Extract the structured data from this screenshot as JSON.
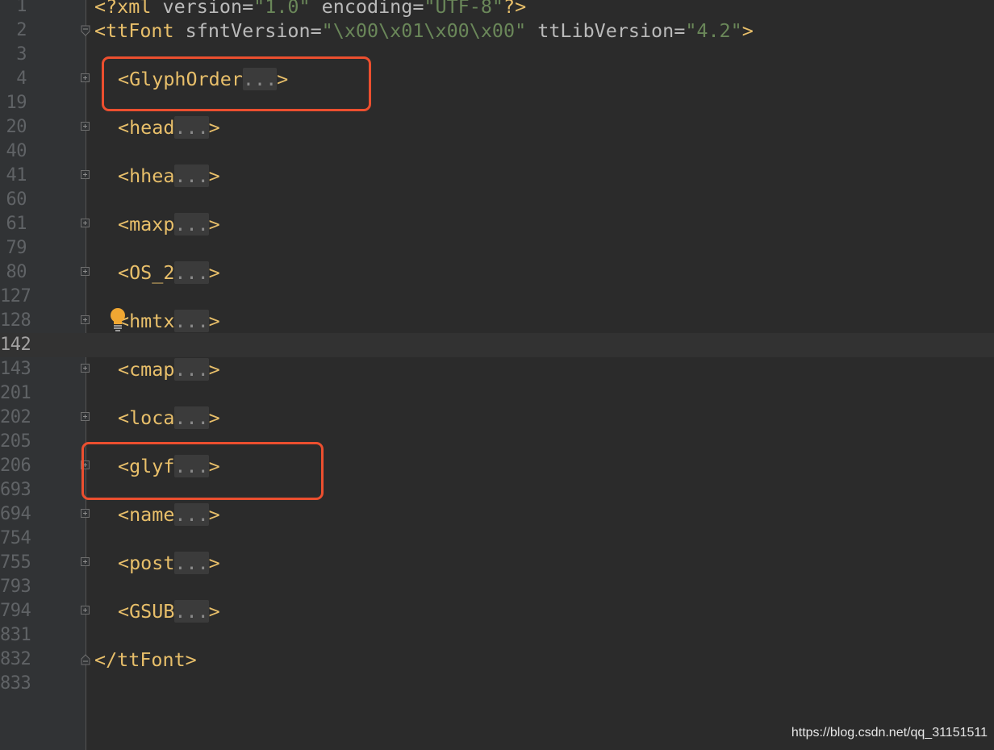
{
  "editor": {
    "lines": [
      {
        "no": "1",
        "indent": 0,
        "kind": "decl"
      },
      {
        "no": "2",
        "indent": 0,
        "kind": "root-open"
      },
      {
        "no": "3",
        "indent": 0,
        "kind": "blank"
      },
      {
        "no": "4",
        "indent": 1,
        "kind": "fold",
        "tag": "<GlyphOrder"
      },
      {
        "no": "19",
        "indent": 0,
        "kind": "blank"
      },
      {
        "no": "20",
        "indent": 1,
        "kind": "fold",
        "tag": "<head"
      },
      {
        "no": "40",
        "indent": 0,
        "kind": "blank"
      },
      {
        "no": "41",
        "indent": 1,
        "kind": "fold",
        "tag": "<hhea"
      },
      {
        "no": "60",
        "indent": 0,
        "kind": "blank"
      },
      {
        "no": "61",
        "indent": 1,
        "kind": "fold",
        "tag": "<maxp"
      },
      {
        "no": "79",
        "indent": 0,
        "kind": "blank"
      },
      {
        "no": "80",
        "indent": 1,
        "kind": "fold",
        "tag": "<OS_2"
      },
      {
        "no": "127",
        "indent": 0,
        "kind": "blank"
      },
      {
        "no": "128",
        "indent": 1,
        "kind": "fold",
        "tag": "<hmtx"
      },
      {
        "no": "142",
        "indent": 0,
        "kind": "blank",
        "current": true
      },
      {
        "no": "143",
        "indent": 1,
        "kind": "fold",
        "tag": "<cmap"
      },
      {
        "no": "201",
        "indent": 0,
        "kind": "blank"
      },
      {
        "no": "202",
        "indent": 1,
        "kind": "fold",
        "tag": "<loca"
      },
      {
        "no": "205",
        "indent": 0,
        "kind": "blank"
      },
      {
        "no": "206",
        "indent": 1,
        "kind": "fold",
        "tag": "<glyf"
      },
      {
        "no": "693",
        "indent": 0,
        "kind": "blank"
      },
      {
        "no": "694",
        "indent": 1,
        "kind": "fold",
        "tag": "<name"
      },
      {
        "no": "754",
        "indent": 0,
        "kind": "blank"
      },
      {
        "no": "755",
        "indent": 1,
        "kind": "fold",
        "tag": "<post"
      },
      {
        "no": "793",
        "indent": 0,
        "kind": "blank"
      },
      {
        "no": "794",
        "indent": 1,
        "kind": "fold",
        "tag": "<GSUB"
      },
      {
        "no": "831",
        "indent": 0,
        "kind": "blank"
      },
      {
        "no": "832",
        "indent": 0,
        "kind": "root-close"
      },
      {
        "no": "833",
        "indent": 0,
        "kind": "blank"
      }
    ],
    "decl": {
      "open": "<?xml ",
      "attr1": "version=",
      "val1": "\"1.0\"",
      "attr2": " encoding=",
      "val2": "\"UTF-8\"",
      "close": "?>"
    },
    "root_open": {
      "tag": "<ttFont ",
      "attr1": "sfntVersion=",
      "val1": "\"\\x00\\x01\\x00\\x00\"",
      "attr2": " ttLibVersion=",
      "val2": "\"4.2\"",
      "close": ">"
    },
    "root_close": "</ttFont>",
    "fold_placeholder": "...",
    "fold_close": ">"
  },
  "colors": {
    "background": "#2b2b2b",
    "tag": "#e8bf6a",
    "attribute": "#bababa",
    "string": "#6a8759",
    "annotation_box": "#ec4f2f",
    "bulb": "#f0a732"
  },
  "icons": {
    "intention": "lightbulb-icon",
    "fold": "fold-expand-icon"
  },
  "watermark": "https://blog.csdn.net/qq_31151511"
}
